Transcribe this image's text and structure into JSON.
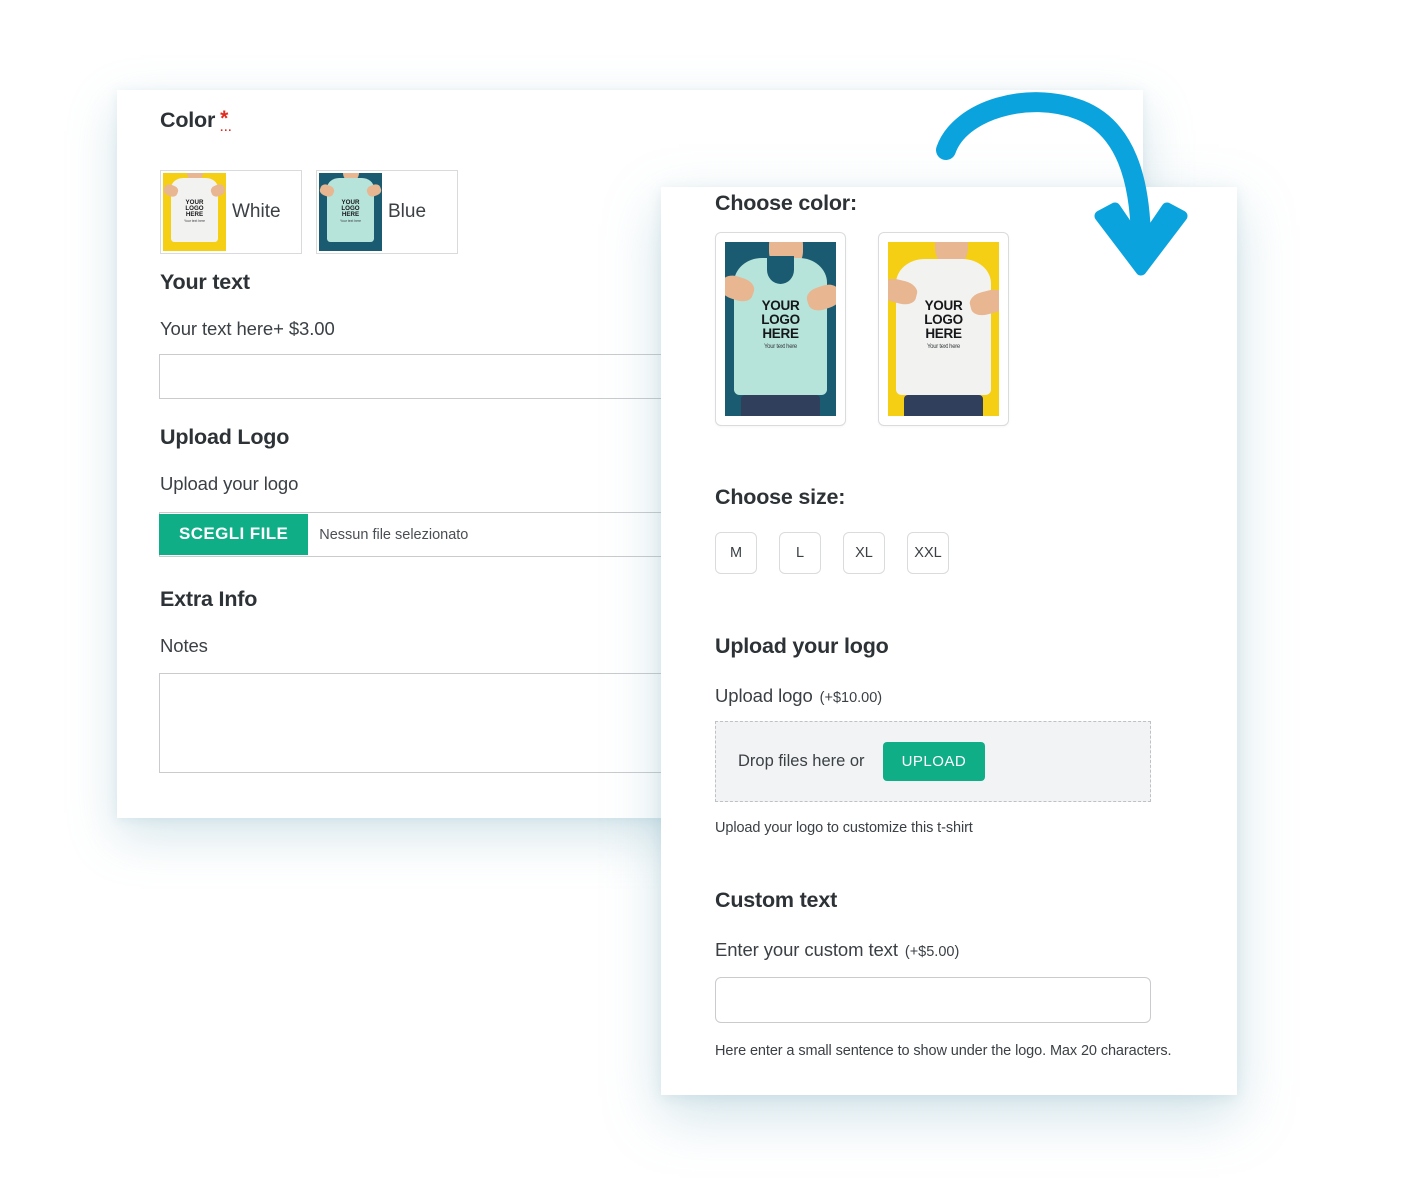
{
  "colors": {
    "accent_green": "#10ae87",
    "accent_blue": "#0ba3de",
    "required_red": "#e02b20",
    "heading_text": "#2d3236",
    "body_text": "#3b4045",
    "border": "#d9dbdd",
    "dropzone_bg": "#f2f3f4",
    "shirt_white": "#f2f2f0",
    "shirt_mint": "#b6e4da",
    "photo_bg_yellow": "#f5cf14",
    "photo_bg_teal": "#1b5b72"
  },
  "left_panel": {
    "color_section": {
      "title": "Color",
      "required_marker": "*",
      "required_dots": "...",
      "swatches": [
        {
          "label": "White",
          "shirt_color": "#f2f2f0",
          "bg_color": "#f5cf14",
          "logo_line1": "YOUR",
          "logo_line2": "LOGO",
          "logo_line3": "HERE",
          "logo_sub": "Your text here"
        },
        {
          "label": "Blue",
          "shirt_color": "#b6e4da",
          "bg_color": "#1b5b72",
          "logo_line1": "YOUR",
          "logo_line2": "LOGO",
          "logo_line3": "HERE",
          "logo_sub": "Your text here"
        }
      ]
    },
    "text_section": {
      "title": "Your text",
      "label": "Your text here+ $3.00",
      "input_value": "",
      "input_placeholder": ""
    },
    "upload_section": {
      "title": "Upload Logo",
      "label": "Upload your logo",
      "button_label": "SCEGLI FILE",
      "no_file_text": "Nessun file selezionato"
    },
    "extra_section": {
      "title": "Extra Info",
      "label": "Notes",
      "textarea_value": "",
      "textarea_placeholder": ""
    }
  },
  "right_panel": {
    "color_section": {
      "title": "Choose color:",
      "options": [
        {
          "name": "mint",
          "shirt_color": "#b6e4da",
          "bg_color": "#1b5b72",
          "logo_line1": "YOUR",
          "logo_line2": "LOGO",
          "logo_line3": "HERE",
          "logo_sub": "Your text here"
        },
        {
          "name": "white",
          "shirt_color": "#f2f2f0",
          "bg_color": "#f5cf14",
          "logo_line1": "YOUR",
          "logo_line2": "LOGO",
          "logo_line3": "HERE",
          "logo_sub": "Your text here"
        }
      ]
    },
    "size_section": {
      "title": "Choose size:",
      "sizes": [
        "M",
        "L",
        "XL",
        "XXL"
      ]
    },
    "logo_section": {
      "title": "Upload your logo",
      "label": "Upload logo",
      "price": "(+$10.00)",
      "drop_text": "Drop files here or",
      "upload_button": "UPLOAD",
      "helper": "Upload your logo to customize this t-shirt"
    },
    "custom_text_section": {
      "title": "Custom text",
      "label": "Enter your custom text",
      "price": "(+$5.00)",
      "input_value": "",
      "input_placeholder": "",
      "helper": "Here enter a small sentence to show under the logo. Max 20 characters."
    }
  },
  "annotation": {
    "arrow_icon": "curved-arrow-down-icon",
    "arrow_color": "#0ba3de"
  }
}
